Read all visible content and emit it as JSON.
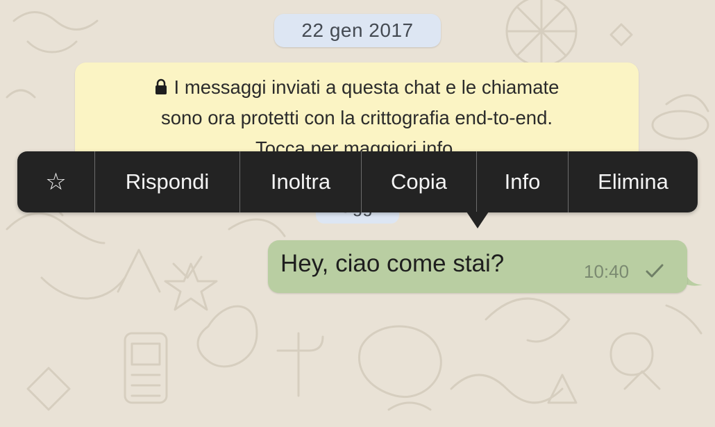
{
  "date_header": "22 gen 2017",
  "encryption_notice": {
    "line1": "I messaggi inviati a questa chat e le chiamate",
    "line2": "sono ora protetti con la crittografia end-to-end.",
    "line3": "Tocca per maggiori info."
  },
  "today_label": "Oggi",
  "context_menu": {
    "star": "☆",
    "reply": "Rispondi",
    "forward": "Inoltra",
    "copy": "Copia",
    "info": "Info",
    "delete": "Elimina"
  },
  "message": {
    "text": "Hey, ciao come stai?",
    "time": "10:40",
    "status_icon": "single-check-icon"
  },
  "colors": {
    "wallpaper": "#e9e2d6",
    "date_pill": "#dde6f3",
    "notice_bg": "#fbf4c4",
    "menu_bg": "#232323",
    "bubble_bg": "#b9cea2"
  }
}
